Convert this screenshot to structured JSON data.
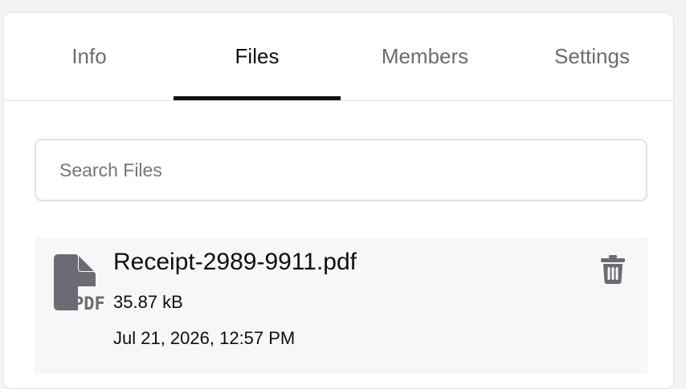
{
  "tabs": [
    {
      "label": "Info",
      "active": false
    },
    {
      "label": "Files",
      "active": true
    },
    {
      "label": "Members",
      "active": false
    },
    {
      "label": "Settings",
      "active": false
    }
  ],
  "search": {
    "placeholder": "Search Files",
    "value": ""
  },
  "files": [
    {
      "name": "Receipt-2989-9911.pdf",
      "size": "35.87 kB",
      "date": "Jul 21, 2026, 12:57 PM",
      "icon": "pdf-file-icon",
      "icon_label": "PDF"
    }
  ],
  "actions": {
    "delete_icon": "trash-icon"
  },
  "colors": {
    "active_tab": "#0f0f12",
    "inactive_tab": "#6b6b73",
    "icon": "#6b6b73",
    "row_background": "#f7f7f8"
  }
}
